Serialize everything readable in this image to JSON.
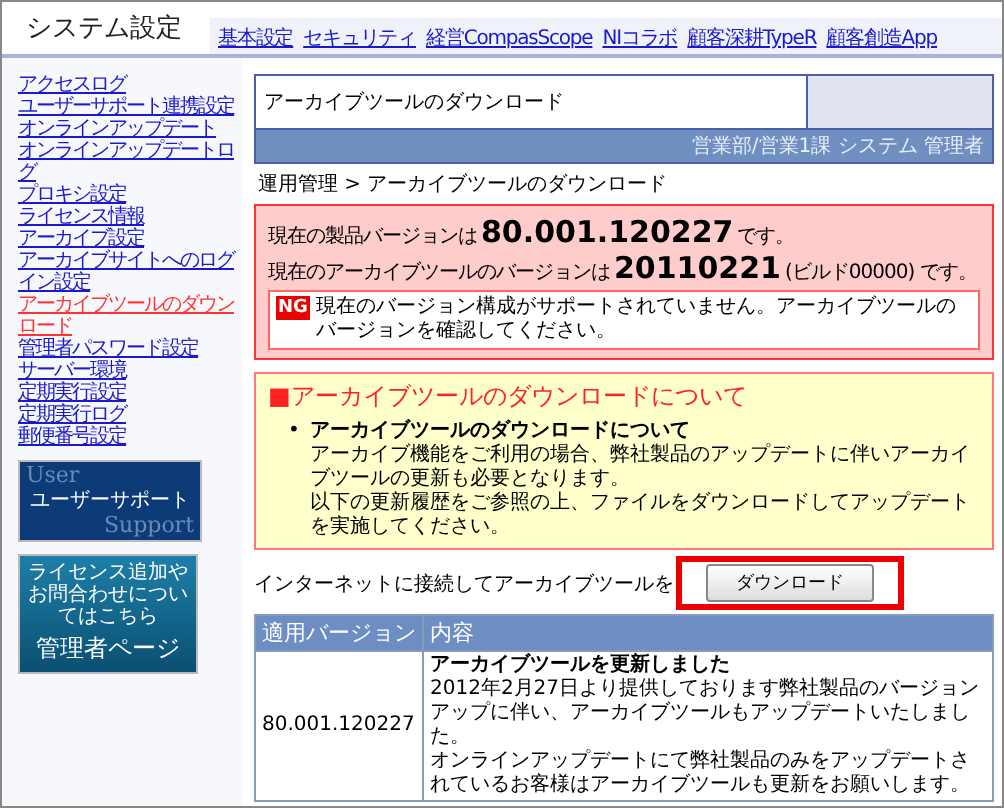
{
  "header": {
    "title": "システム設定",
    "tabs": [
      "基本設定",
      "セキュリティ",
      "経営CompasScope",
      "NIコラボ",
      "顧客深耕TypeR",
      "顧客創造App"
    ]
  },
  "sidebar": {
    "items": [
      {
        "label": "アクセスログ",
        "selected": false
      },
      {
        "label": "ユーザーサポート連携設定",
        "selected": false
      },
      {
        "label": "オンラインアップデート",
        "selected": false
      },
      {
        "label": "オンラインアップデートログ",
        "selected": false
      },
      {
        "label": "プロキシ設定",
        "selected": false
      },
      {
        "label": "ライセンス情報",
        "selected": false
      },
      {
        "label": "アーカイブ設定",
        "selected": false
      },
      {
        "label": "アーカイブサイトへのログイン設定",
        "selected": false
      },
      {
        "label": "アーカイブツールのダウンロード",
        "selected": true
      },
      {
        "label": "管理者パスワード設定",
        "selected": false
      },
      {
        "label": "サーバー環境",
        "selected": false
      },
      {
        "label": "定期実行設定",
        "selected": false
      },
      {
        "label": "定期実行ログ",
        "selected": false
      },
      {
        "label": "郵便番号設定",
        "selected": false
      }
    ],
    "banners": [
      {
        "kind": "support",
        "backdrop": [
          "User",
          "Support"
        ],
        "label": "ユーザーサポート"
      },
      {
        "kind": "admin",
        "note": "ライセンス追加やお問合わせについてはこちら",
        "label": "管理者ページ"
      }
    ]
  },
  "page": {
    "title": "アーカイブツールのダウンロード",
    "user": "営業部/営業1課 システム 管理者",
    "breadcrumb": "運用管理 > アーカイブツールのダウンロード"
  },
  "status": {
    "product": {
      "prefix": "現在の製品バージョンは",
      "version": "80.001.120227",
      "suffix": "です。"
    },
    "archive": {
      "prefix": "現在のアーカイブツールのバージョンは",
      "version": "20110221",
      "build": "(ビルド00000)",
      "suffix": "です。"
    },
    "alert": {
      "badge": "NG",
      "message": "現在のバージョン構成がサポートされていません。アーカイブツールのバージョンを確認してください。"
    }
  },
  "notice": {
    "heading": "■アーカイブツールのダウンロードについて",
    "items": [
      {
        "marker": "•",
        "title": "アーカイブツールのダウンロードについて",
        "paragraphs": [
          "アーカイブ機能をご利用の場合、弊社製品のアップデートに伴いアーカイブツールの更新も必要となります。",
          "以下の更新履歴をご参照の上、ファイルをダウンロードしてアップデートを実施してください。"
        ]
      }
    ]
  },
  "download": {
    "text": "インターネットに接続してアーカイブツールを",
    "button": "ダウンロード",
    "highlighted": true
  },
  "history": {
    "columns": [
      "適用バージョン",
      "内容"
    ],
    "rows": [
      {
        "version": "80.001.120227",
        "title": "アーカイブツールを更新しました",
        "paragraphs": [
          "2012年2月27日より提供しております弊社製品のバージョンアップに伴い、アーカイブツールもアップデートいたしました。",
          "オンラインアップデートにて弊社製品のみをアップデートされているお客様はアーカイブツールも更新をお願いします。"
        ]
      }
    ]
  }
}
